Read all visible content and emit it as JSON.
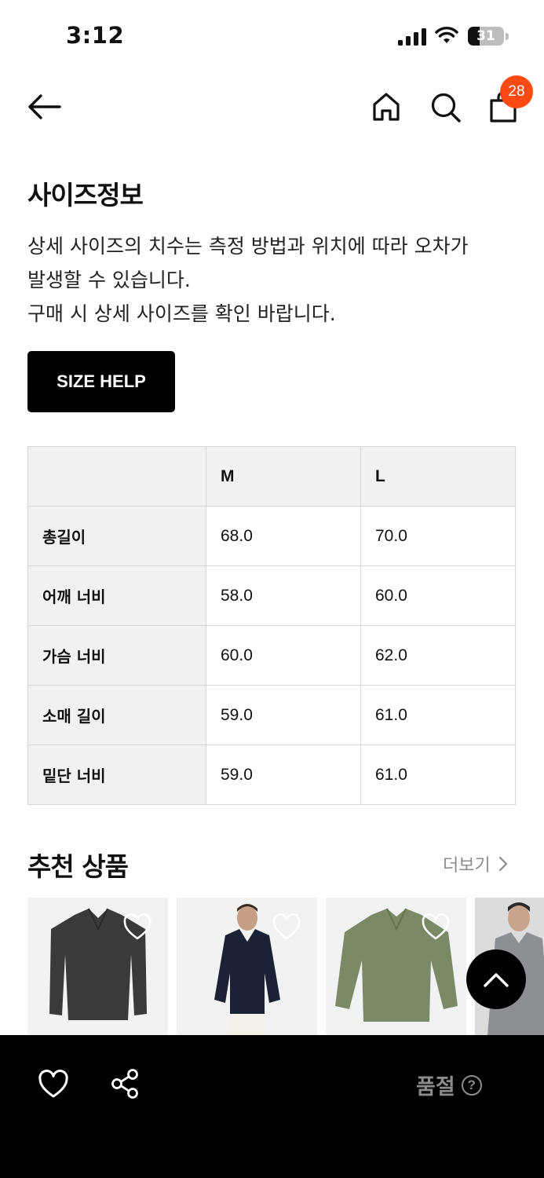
{
  "status": {
    "time": "3:12",
    "battery": "31"
  },
  "header": {
    "cart_count": "28"
  },
  "size_info": {
    "title": "사이즈정보",
    "description_lines": [
      "상세 사이즈의 치수는 측정 방법과 위치에 따라 오차가",
      "발생할 수 있습니다.",
      "구매 시 상세 사이즈를 확인 바랍니다."
    ],
    "help_button_label": "SIZE HELP"
  },
  "size_table": {
    "columns": [
      "",
      "M",
      "L"
    ],
    "rows": [
      {
        "label": "총길이",
        "values": [
          "68.0",
          "70.0"
        ]
      },
      {
        "label": "어깨 너비",
        "values": [
          "58.0",
          "60.0"
        ]
      },
      {
        "label": "가슴 너비",
        "values": [
          "60.0",
          "62.0"
        ]
      },
      {
        "label": "소매 길이",
        "values": [
          "59.0",
          "61.0"
        ]
      },
      {
        "label": "밑단 너비",
        "values": [
          "59.0",
          "61.0"
        ]
      }
    ]
  },
  "recommended": {
    "title": "추천 상품",
    "more_label": "더보기",
    "products": [
      {
        "name": "charcoal-polo-knit",
        "color": "#3a3a3a"
      },
      {
        "name": "navy-polo-knit-model",
        "color": "#1b2235"
      },
      {
        "name": "green-polo-knit",
        "color": "#7b8a66"
      },
      {
        "name": "grey-polo-knit-model",
        "color": "#8d8f93"
      }
    ]
  },
  "bottom_bar": {
    "status_label": "품절",
    "help_glyph": "?"
  },
  "icons": [
    "back-arrow-icon",
    "home-icon",
    "search-icon",
    "shopping-bag-icon",
    "heart-icon",
    "share-icon",
    "chevron-up-icon",
    "chevron-right-icon",
    "help-icon"
  ]
}
